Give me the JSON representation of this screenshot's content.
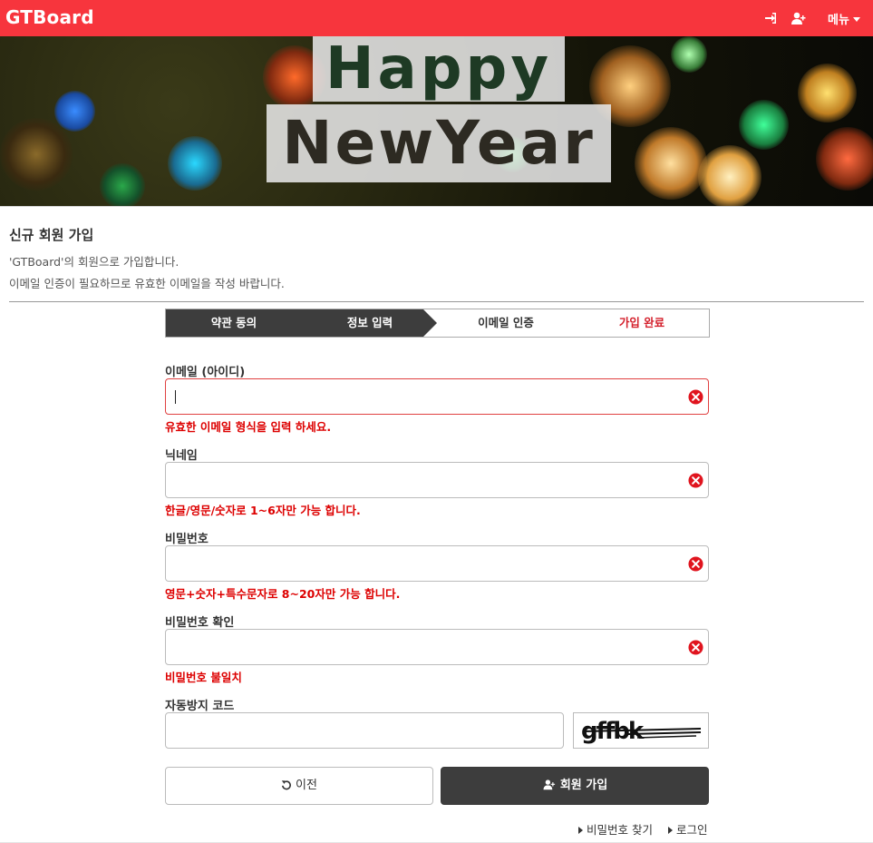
{
  "app": {
    "brand": "GTBoard",
    "menu_label": "메뉴"
  },
  "banner": {
    "line1": "Happy",
    "line2": "NewYear"
  },
  "page": {
    "title": "신규 회원 가입",
    "intro1": "'GTBoard'의 회원으로 가입합니다.",
    "intro2": "이메일 인증이 필요하므로 유효한 이메일을 작성 바랍니다."
  },
  "steps": [
    {
      "label": "약관 동의",
      "state": "done"
    },
    {
      "label": "정보 입력",
      "state": "active"
    },
    {
      "label": "이메일 인증",
      "state": "pending"
    },
    {
      "label": "가입 완료",
      "state": "pending"
    }
  ],
  "form": {
    "email": {
      "label": "이메일 (아이디)",
      "value": "",
      "error": "유효한 이메일 형식을 입력 하세요."
    },
    "nickname": {
      "label": "닉네임",
      "value": "",
      "error": "한글/영문/숫자로 1~6자만 가능 합니다."
    },
    "password": {
      "label": "비밀번호",
      "value": "",
      "error": "영문+숫자+특수문자로 8~20자만 가능 합니다."
    },
    "password_confirm": {
      "label": "비밀번호 확인",
      "value": "",
      "error": "비밀번호 불일치"
    },
    "captcha": {
      "label": "자동방지 코드",
      "value": "",
      "image_text": "gffbk"
    }
  },
  "buttons": {
    "prev": "이전",
    "join": "회원 가입"
  },
  "links": {
    "find_password": "비밀번호 찾기",
    "login": "로그인"
  },
  "colors": {
    "brand": "#f7353d",
    "dark": "#3d3d3d",
    "error": "#dd0000",
    "step_done_text": "#d4202c"
  },
  "icons": {
    "login": "sign-in-icon",
    "signup": "user-plus-icon",
    "clear": "times-circle-icon",
    "prev": "undo-icon"
  }
}
